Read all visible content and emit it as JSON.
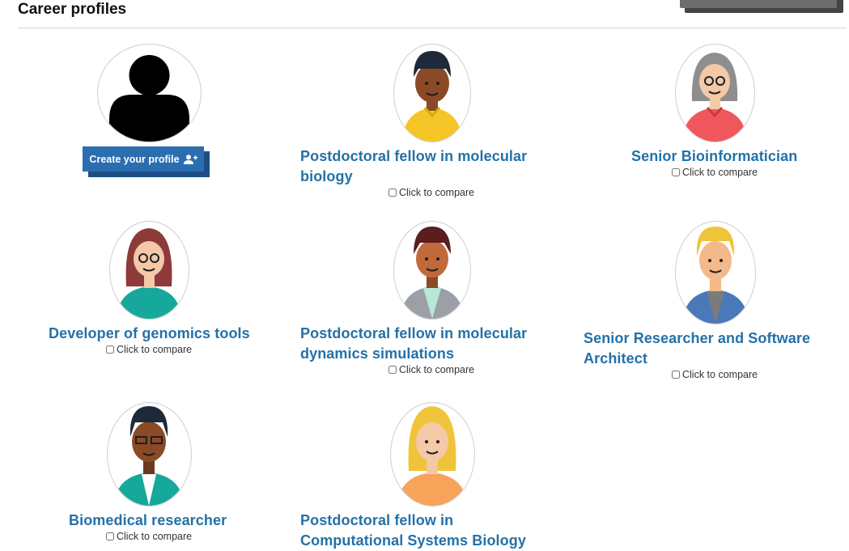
{
  "page": {
    "title": "Career profiles"
  },
  "create": {
    "label": "Create your profile"
  },
  "compare_label": "Click to compare",
  "profiles": [
    {
      "name": "Postdoctoral fellow in molecular biology",
      "avatar": "man-yellow-shirt-icon"
    },
    {
      "name": "Senior Bioinformatician",
      "avatar": "woman-grey-hair-glasses-icon"
    },
    {
      "name": "Developer of genomics tools",
      "avatar": "woman-red-hair-glasses-icon"
    },
    {
      "name": "Postdoctoral fellow in molecular dynamics simulations",
      "avatar": "man-grey-blazer-icon"
    },
    {
      "name": "Senior Researcher and Software Architect",
      "avatar": "man-blond-blue-jacket-icon"
    },
    {
      "name": "Biomedical researcher",
      "avatar": "man-glasses-teal-jacket-icon"
    },
    {
      "name": "Postdoctoral fellow in Computational Systems Biology",
      "avatar": "woman-blond-orange-shirt-icon"
    }
  ],
  "colors": {
    "link": "#2471a8",
    "button": "#2b6eb0",
    "button_shadow": "#1b4d86"
  }
}
